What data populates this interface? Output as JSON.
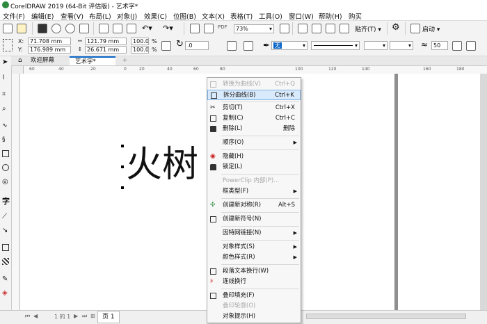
{
  "window": {
    "title": "CorelDRAW 2019 (64-Bit 评估版) - 艺术字*"
  },
  "menu": [
    "文件(F)",
    "编辑(E)",
    "查看(V)",
    "布局(L)",
    "对象(J)",
    "效果(C)",
    "位图(B)",
    "文本(X)",
    "表格(T)",
    "工具(O)",
    "窗口(W)",
    "帮助(H)",
    "购买"
  ],
  "toolbar": {
    "zoom": "73%",
    "snap_label": "贴齐(T)",
    "launch_label": "启动"
  },
  "property_bar": {
    "x": "71.708 mm",
    "y": "176.989 mm",
    "width": "121.79 mm",
    "height": "26.671 mm",
    "scale_x": "100.0",
    "scale_y": "100.0",
    "percent": "%",
    "rotation": ".0",
    "outline_none": "无",
    "miter": "50",
    "x_label": "X:",
    "y_label": "Y:"
  },
  "tabs": {
    "welcome": "欢迎屏幕",
    "doc": "艺术字*",
    "add": "+"
  },
  "ruler": {
    "h_ticks": [
      "60",
      "40",
      "20",
      "0",
      "20",
      "40",
      "60",
      "80",
      "100",
      "120",
      "140",
      "160",
      "180"
    ]
  },
  "canvas": {
    "text": "火树"
  },
  "bottom": {
    "page_label": "页 1",
    "page_info": "1 的 1"
  },
  "context_menu": {
    "items": [
      {
        "label": "转换为曲线(V)",
        "shortcut": "Ctrl+Q",
        "disabled": true,
        "icon": "convert-curve-icon"
      },
      {
        "label": "拆分曲线(B)",
        "shortcut": "Ctrl+K",
        "highlight": true,
        "icon": "break-curve-icon"
      },
      {
        "sep": true
      },
      {
        "label": "剪切(T)",
        "shortcut": "Ctrl+X",
        "icon": "scissors-icon"
      },
      {
        "label": "复制(C)",
        "shortcut": "Ctrl+C",
        "icon": "copy-icon"
      },
      {
        "label": "删除(L)",
        "shortcut": "删除",
        "icon": "trash-icon"
      },
      {
        "sep": true
      },
      {
        "label": "顺序(O)",
        "submenu": true
      },
      {
        "sep": true
      },
      {
        "label": "隐藏(H)",
        "icon": "eye-icon"
      },
      {
        "label": "锁定(L)",
        "icon": "lock-icon"
      },
      {
        "sep": true
      },
      {
        "label": "PowerClip 内部(P)...",
        "disabled": true
      },
      {
        "label": "框类型(F)",
        "submenu": true
      },
      {
        "sep": true
      },
      {
        "label": "创建新对称(R)",
        "shortcut": "Alt+S",
        "icon": "symmetry-icon"
      },
      {
        "sep": true
      },
      {
        "label": "创建新符号(N)",
        "icon": "symbol-icon"
      },
      {
        "sep": true
      },
      {
        "label": "因特网链接(N)",
        "submenu": true
      },
      {
        "sep": true
      },
      {
        "label": "对象样式(S)",
        "submenu": true
      },
      {
        "label": "颜色样式(R)",
        "submenu": true
      },
      {
        "sep": true
      },
      {
        "label": "段落文本换行(W)",
        "icon": "wrap-text-icon"
      },
      {
        "label": "连线换行",
        "icon": "connector-wrap-icon"
      },
      {
        "sep": true
      },
      {
        "label": "叠印填充(F)",
        "icon": "overprint-fill-icon"
      },
      {
        "label": "叠印轮廓(O)",
        "disabled": true
      },
      {
        "label": "对象提示(H)"
      }
    ]
  },
  "colors": {
    "accent": "#0a64c8",
    "highlight": "#d8eafb"
  }
}
